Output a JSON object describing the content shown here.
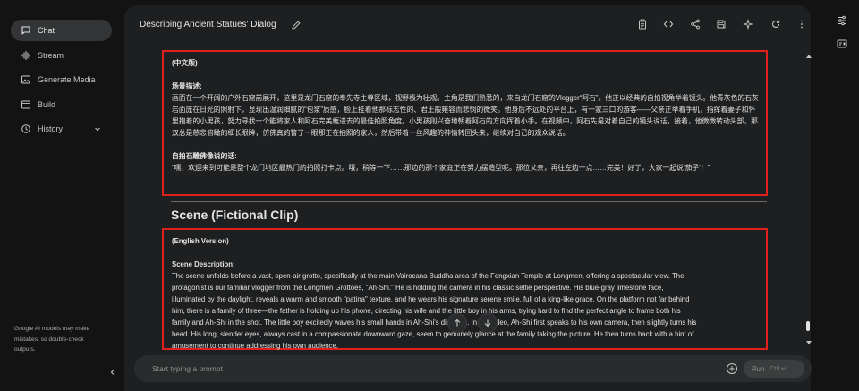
{
  "sidebar": {
    "items": [
      {
        "label": "Chat",
        "icon": "chat-icon"
      },
      {
        "label": "Stream",
        "icon": "stream-icon"
      },
      {
        "label": "Generate Media",
        "icon": "image-icon"
      },
      {
        "label": "Build",
        "icon": "build-icon"
      },
      {
        "label": "History",
        "icon": "history-icon"
      }
    ],
    "note": "Google AI models may make mistakes, so double-check outputs."
  },
  "header": {
    "title": "Describing Ancient Statues' Dialog"
  },
  "content": {
    "zh": {
      "version_label": "(中文版)",
      "scene_label": "场景描述:",
      "scene_text": "画面在一个开阔的户外石窟前展开，这里是龙门石窟的奉先寺主尊区域，视野极为壮观。主角是我们熟悉的，来自龙门石窟的Vlogger“阿石”。他正以经典的自拍视角举着镜头。他青灰色的石灰岩面庞在日光的照射下，显现出温润细腻的“包浆”质感，脸上挂着他那标志性的、君王般雍容而悲悯的微笑。他身后不远处的平台上，有一家三口的游客——父亲正举着手机，指挥着妻子和怀里抱着的小男孩，努力寻找一个能将家人和阿石完美框进去的最佳拍照角度。小男孩则兴奋地朝着阿石的方向挥着小手。在视频中，阿石先是对着自己的镜头说话，接着，他微微转动头部，那双总是慈悲俯瞰的细长眼眸，仿佛真的瞥了一眼那正在拍照的家人，然后带着一丝风趣的神情转回头来，继续对自己的观众说话。",
      "speech_label": "自拍石雕佛像说的话:",
      "speech_text": "“嘿，欢迎来到可能是整个龙门地区最热门的拍照打卡点。哦，稍等一下……那边的那个家庭正在努力摆造型呢。那位父亲，再往左边一点……完美！好了，大家一起说‘茄子’！”"
    },
    "scene_heading": "Scene (Fictional Clip)",
    "en": {
      "version_label": "(English Version)",
      "scene_label": "Scene Description:",
      "lines": [
        "The scene unfolds before a vast, open-air grotto, specifically at the main Vairocana Buddha area of the Fengxian Temple at Longmen, offering a spectacular view. The",
        "protagonist is our familiar vlogger from the Longmen Grottoes, \"Ah-Shi.\" He is holding the camera in his classic selfie perspective. His blue-gray limestone face,",
        "illuminated by the daylight, reveals a warm and smooth \"patina\" texture, and he wears his signature serene smile, full of a king-like grace. On the platform not far behind",
        "him, there is a family of three—the father is holding up his phone, directing his wife and the little boy in his arms, trying hard to find the perfect angle to frame both his",
        "family and Ah-Shi in the shot. The little boy excitedly waves his small hands in Ah-Shi's direction. In the video, Ah-Shi first speaks to his own camera, then slightly turns his",
        "head. His long, slender eyes, always cast in a compassionate downward gaze, seem to genuinely glance at the family taking the picture. He then turns back with a hint of",
        "amusement to continue addressing his own audience."
      ]
    }
  },
  "prompt": {
    "placeholder": "Start typing a prompt",
    "run_label": "Run",
    "run_shortcut": "Ctrl ↵"
  },
  "colors": {
    "background": "#131314",
    "panel": "#1e1f20",
    "highlight_border": "#e0201b",
    "active_nav": "#333537"
  }
}
